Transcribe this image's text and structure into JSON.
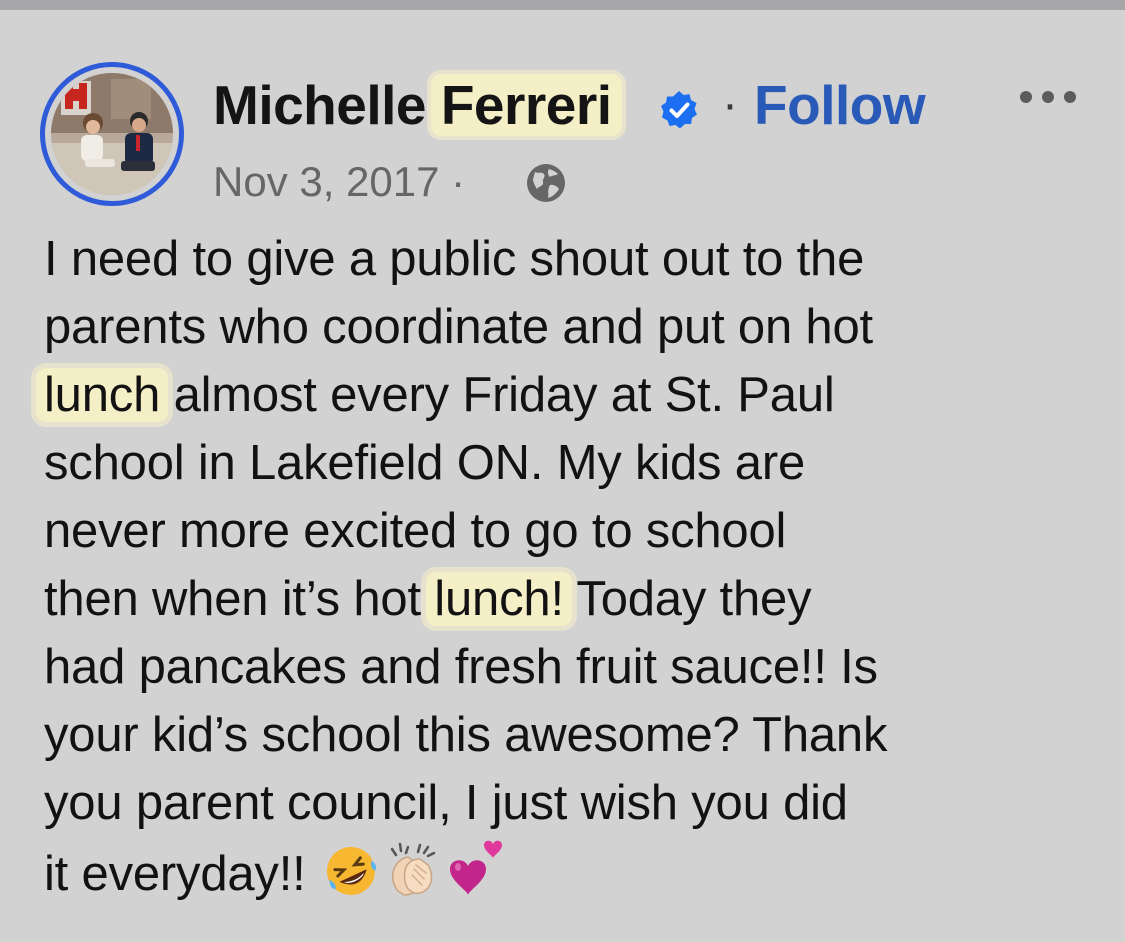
{
  "post": {
    "author_first": "Michelle",
    "author_last": "Ferreri",
    "separator": "·",
    "follow_label": "Follow",
    "date": "Nov 3, 2017 ·",
    "audience_icon": "globe-icon",
    "more_icon": "more-options-icon",
    "verified_icon": "verified-badge-icon",
    "body_lines": [
      {
        "pre": "I need to give a public shout out to the",
        "hl": "",
        "post": ""
      },
      {
        "pre": "parents who coordinate and put on hot",
        "hl": "",
        "post": ""
      },
      {
        "pre": "",
        "hl": "lunch",
        "post": " almost every Friday at St. Paul"
      },
      {
        "pre": "school in Lakefield ON. My kids are",
        "hl": "",
        "post": ""
      },
      {
        "pre": "never more excited to go to school",
        "hl": "",
        "post": ""
      },
      {
        "pre": "then when it’s hot ",
        "hl": "lunch!",
        "post": " Today they"
      },
      {
        "pre": "had pancakes and fresh fruit sauce!! Is",
        "hl": "",
        "post": ""
      },
      {
        "pre": "your kid’s school this awesome? Thank",
        "hl": "",
        "post": ""
      },
      {
        "pre": "you parent council, I just wish you did",
        "hl": "",
        "post": ""
      },
      {
        "pre": "it everyday!!",
        "hl": "",
        "post": ""
      }
    ],
    "emojis": [
      "rolling-on-floor-laughing-emoji",
      "clapping-hands-emoji",
      "two-hearts-emoji"
    ]
  },
  "colors": {
    "background": "#d2d2d2",
    "highlight": "#f5efc8",
    "link": "#2a5ab8",
    "avatar_ring": "#2f5bd9",
    "verified": "#1d6ff2"
  }
}
